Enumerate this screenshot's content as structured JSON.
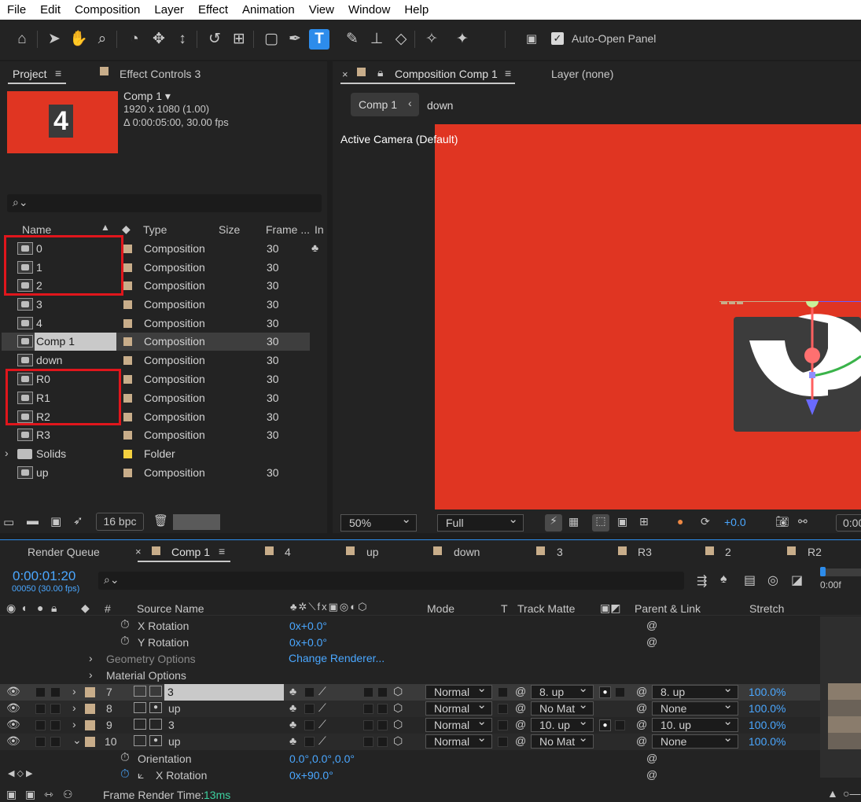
{
  "menu": [
    "File",
    "Edit",
    "Composition",
    "Layer",
    "Effect",
    "Animation",
    "View",
    "Window",
    "Help"
  ],
  "toolbar": {
    "auto_open_label": "Auto-Open Panel",
    "icons": [
      "home-icon",
      "selection-tool-icon",
      "hand-tool-icon",
      "zoom-tool-icon",
      "orbit-camera-icon",
      "pan-camera-icon",
      "dolly-camera-icon",
      "rotate-tool-icon",
      "anchor-point-tool-icon",
      "rectangle-tool-icon",
      "pen-tool-icon",
      "type-tool-icon",
      "brush-tool-icon",
      "clone-stamp-icon",
      "eraser-icon",
      "roto-brush-icon",
      "puppet-pin-icon"
    ]
  },
  "project_panel": {
    "tab_project": "Project",
    "tab_effect_controls": "Effect Controls 3",
    "comp_thumb_number": "4",
    "comp_name": "Comp 1",
    "comp_res": "1920 x 1080 (1.00)",
    "comp_duration": "Δ 0:00:05:00, 30.00 fps",
    "search_placeholder": "",
    "columns": {
      "name": "Name",
      "type": "Type",
      "size": "Size",
      "frame": "Frame ...",
      "in": "In"
    },
    "items": [
      {
        "name": "0",
        "type": "Composition",
        "frame": "30"
      },
      {
        "name": "1",
        "type": "Composition",
        "frame": "30"
      },
      {
        "name": "2",
        "type": "Composition",
        "frame": "30"
      },
      {
        "name": "3",
        "type": "Composition",
        "frame": "30"
      },
      {
        "name": "4",
        "type": "Composition",
        "frame": "30"
      },
      {
        "name": "Comp 1",
        "type": "Composition",
        "frame": "30"
      },
      {
        "name": "down",
        "type": "Composition",
        "frame": "30"
      },
      {
        "name": "R0",
        "type": "Composition",
        "frame": "30"
      },
      {
        "name": "R1",
        "type": "Composition",
        "frame": "30"
      },
      {
        "name": "R2",
        "type": "Composition",
        "frame": "30"
      },
      {
        "name": "R3",
        "type": "Composition",
        "frame": "30"
      },
      {
        "name": "Solids",
        "type": "Folder",
        "frame": ""
      },
      {
        "name": "up",
        "type": "Composition",
        "frame": "30"
      }
    ],
    "bpc": "16 bpc"
  },
  "comp_panel": {
    "tab_label": "Composition Comp 1",
    "layer_tab": "Layer (none)",
    "breadcrumb_comp": "Comp 1",
    "breadcrumb_next": "down",
    "camera_label": "Active Camera (Default)",
    "zoom": "50%",
    "resolution": "Full",
    "exposure": "+0.0",
    "timecode_partial": "0:00"
  },
  "timeline": {
    "tabs": [
      "Render Queue",
      "Comp 1",
      "4",
      "up",
      "down",
      "3",
      "R3",
      "2",
      "R2"
    ],
    "timecode": "0:00:01:20",
    "frame_info": "00050 (30.00 fps)",
    "ruler_start": "0:00f",
    "headers": {
      "num": "#",
      "source": "Source Name",
      "mode": "Mode",
      "t": "T",
      "track_matte": "Track Matte",
      "parent": "Parent & Link",
      "stretch": "Stretch"
    },
    "props_top": [
      {
        "label": "X Rotation",
        "value": "0x+0.0°"
      },
      {
        "label": "Y Rotation",
        "value": "0x+0.0°"
      }
    ],
    "geometry_label": "Geometry Options",
    "geometry_value": "Change Renderer...",
    "material_label": "Material Options",
    "layers": [
      {
        "num": "7",
        "name": "3",
        "mode": "Normal",
        "matte": "8. up",
        "parent": "8. up",
        "stretch": "100.0%"
      },
      {
        "num": "8",
        "name": "up",
        "mode": "Normal",
        "matte": "No Mat",
        "parent": "None",
        "stretch": "100.0%"
      },
      {
        "num": "9",
        "name": "3",
        "mode": "Normal",
        "matte": "10. up",
        "parent": "10. up",
        "stretch": "100.0%"
      },
      {
        "num": "10",
        "name": "up",
        "mode": "Normal",
        "matte": "No Mat",
        "parent": "None",
        "stretch": "100.0%"
      }
    ],
    "props_bottom": [
      {
        "label": "Orientation",
        "value": "0.0°,0.0°,0.0°"
      },
      {
        "label": "X Rotation",
        "value": "0x+90.0°"
      }
    ],
    "frame_render_label": "Frame Render Time:",
    "frame_render_value": "13ms"
  },
  "colors": {
    "accent": "#2d8ceb",
    "comp_bg": "#e03522",
    "highlight_box": "#e0161c",
    "label_tan": "#c8ad8a",
    "folder_yellow": "#f4d03f",
    "blue_value": "#4aa7ff"
  }
}
